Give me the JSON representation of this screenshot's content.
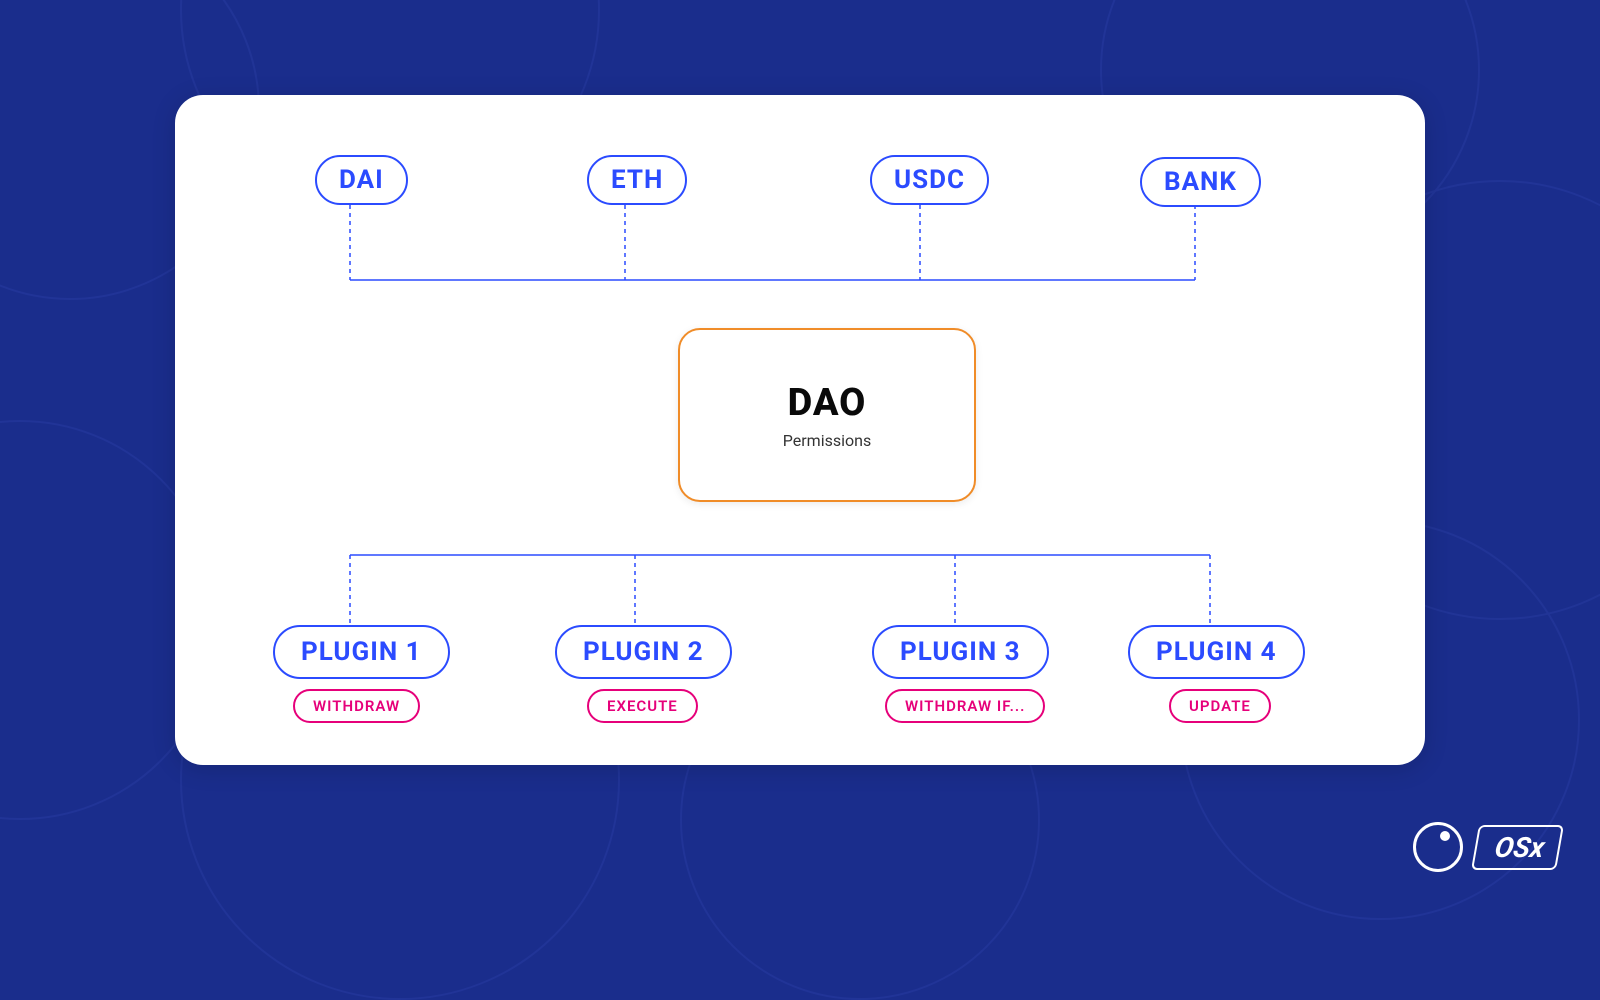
{
  "assets": [
    {
      "id": "dai",
      "label": "DAI"
    },
    {
      "id": "eth",
      "label": "ETH"
    },
    {
      "id": "usdc",
      "label": "USDC"
    },
    {
      "id": "bank",
      "label": "BANK"
    }
  ],
  "dao": {
    "title": "DAO",
    "subtitle": "Permissions"
  },
  "plugins": [
    {
      "id": "plugin1",
      "label": "PLUGIN 1",
      "action": "WITHDRAW"
    },
    {
      "id": "plugin2",
      "label": "PLUGIN 2",
      "action": "EXECUTE"
    },
    {
      "id": "plugin3",
      "label": "PLUGIN 3",
      "action": "WITHDRAW IF..."
    },
    {
      "id": "plugin4",
      "label": "PLUGIN 4",
      "action": "UPDATE"
    }
  ],
  "branding": {
    "name": "OSx"
  },
  "colors": {
    "bg": "#1a2d8c",
    "primary_blue": "#2b4bff",
    "accent_orange": "#f08c28",
    "accent_pink": "#e6007a"
  }
}
